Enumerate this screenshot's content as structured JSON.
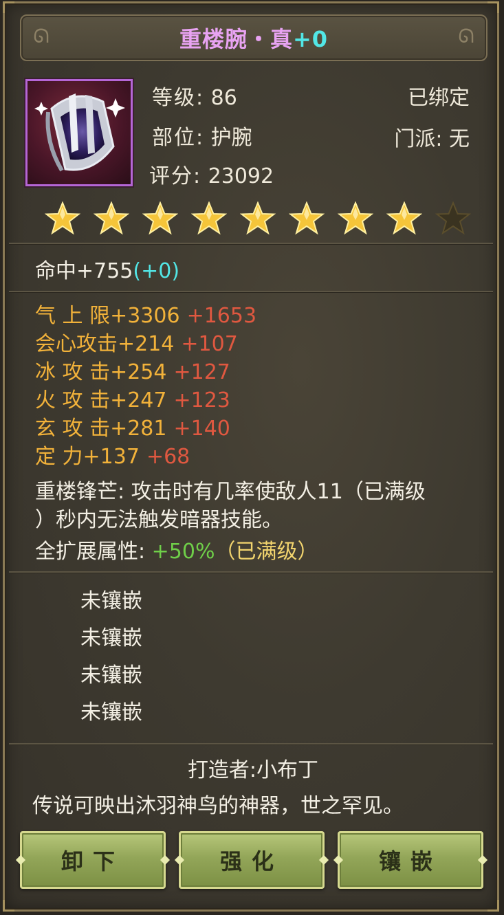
{
  "title": {
    "name": "重楼腕・真",
    "plus": "+0"
  },
  "item": {
    "icon": "bracer-icon",
    "level_label": "等级:",
    "level_value": "86",
    "slot_label": "部位:",
    "slot_value": "护腕",
    "score_label": "评分:",
    "score_value": "23092",
    "bound": "已绑定",
    "sect_label": "门派:",
    "sect_value": "无",
    "stars_filled": 8,
    "stars_total": 9
  },
  "main_attr": {
    "text": "命中+755",
    "bonus": "(+0)"
  },
  "attrs": [
    {
      "base": "气 上 限+3306",
      "add": "+1653"
    },
    {
      "base": "会心攻击+214",
      "add": "+107"
    },
    {
      "base": "冰 攻 击+254",
      "add": "+127"
    },
    {
      "base": "火 攻 击+247",
      "add": "+123"
    },
    {
      "base": "玄 攻 击+281",
      "add": "+140"
    },
    {
      "base": "定  力+137",
      "add": "+68"
    }
  ],
  "skill": {
    "line1": "重楼锋芒: 攻击时有几率使敌人11（已满级",
    "line2": "）秒内无法触发暗器技能。"
  },
  "extension": {
    "label": "全扩展属性:",
    "percent": "+50%",
    "status": "（已满级）"
  },
  "sockets": [
    "未镶嵌",
    "未镶嵌",
    "未镶嵌",
    "未镶嵌"
  ],
  "maker": "打造者:小布丁",
  "description": "传说可映出沐羽神鸟的神器，世之罕见。",
  "buttons": {
    "unequip": "卸下",
    "enhance": "强化",
    "inlay": "镶嵌"
  },
  "colors": {
    "title": "#e8a3f2",
    "cyan": "#52e6e6",
    "attr": "#f2b23a",
    "bonus": "#e05840",
    "green": "#6fcf49",
    "frame": "#b566d6"
  }
}
